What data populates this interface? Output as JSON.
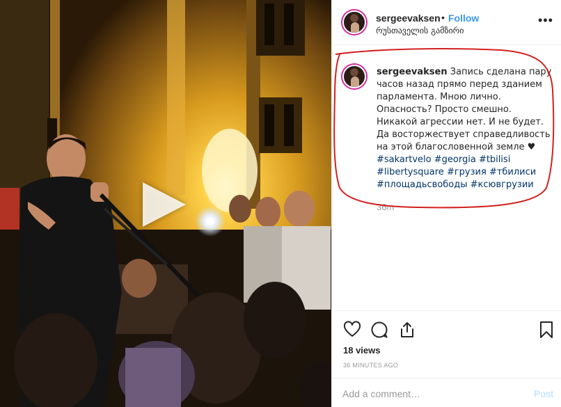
{
  "post": {
    "username": "sergeevaksen",
    "separator": "•",
    "follow_label": "Follow",
    "location": "რუსთაველის გამზირი",
    "more_label": "•••"
  },
  "caption": {
    "username": "sergeevaksen",
    "text": "Запись сделана пару часов назад прямо перед зданием парламента. Мною лично. Опасность? Просто смешно. Никакой агрессии нет. И не будет. Да восторжествует справедливость на этой благословенной земле ♥",
    "hashtags": [
      "#sakartvelo",
      "#georgia",
      "#tbilisi",
      "#libertysquare",
      "#грузия",
      "#тбилиси",
      "#площадьсвободы",
      "#ксювгрузии"
    ],
    "age": "36m"
  },
  "stats": {
    "views": "18 views",
    "posted": "36 MINUTES AGO"
  },
  "comment_box": {
    "placeholder": "Add a comment…",
    "post_label": "Post"
  },
  "icons": {
    "like": "heart-icon",
    "comment": "comment-bubble-icon",
    "share": "share-icon",
    "save": "bookmark-icon",
    "play": "play-icon"
  },
  "colors": {
    "link": "#3897f0",
    "hashtag": "#003569",
    "annotation": "#d32020"
  }
}
